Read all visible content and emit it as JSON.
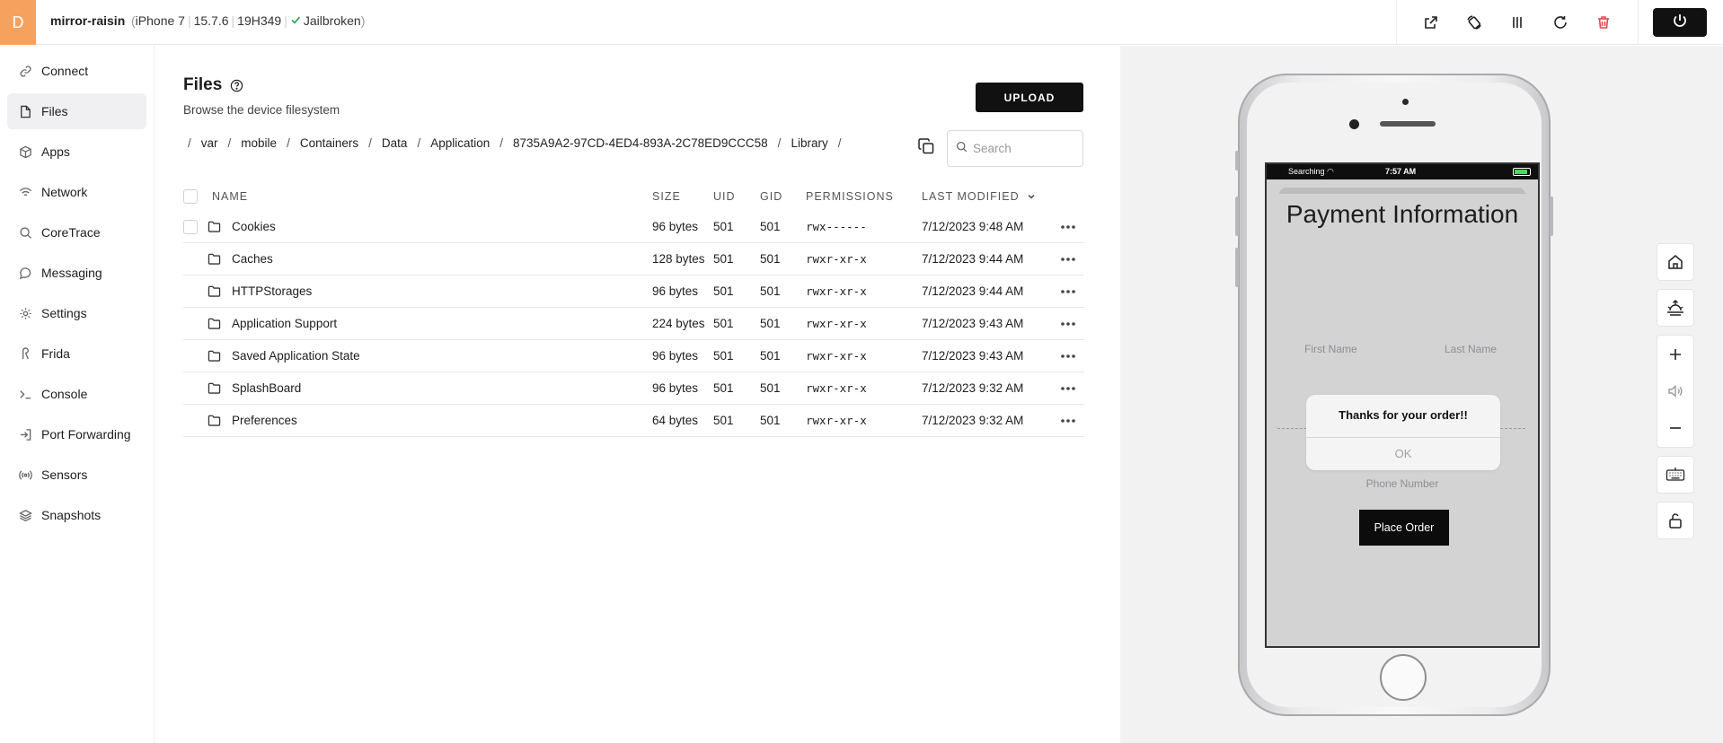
{
  "topbar": {
    "avatar_letter": "D",
    "device_name": "mirror-raisin",
    "device_model": "iPhone 7",
    "ios_version": "15.7.6",
    "build": "19H349",
    "jailbreak_status": "Jailbroken",
    "tools": [
      "external-link-icon",
      "rotate-device-icon",
      "pause-icon",
      "refresh-icon",
      "trash-icon"
    ],
    "power_icon": "power-icon"
  },
  "sidebar": {
    "items": [
      {
        "label": "Connect",
        "icon": "link-icon"
      },
      {
        "label": "Files",
        "icon": "file-icon",
        "active": true
      },
      {
        "label": "Apps",
        "icon": "cube-icon"
      },
      {
        "label": "Network",
        "icon": "wifi-icon"
      },
      {
        "label": "CoreTrace",
        "icon": "search-icon"
      },
      {
        "label": "Messaging",
        "icon": "chat-icon"
      },
      {
        "label": "Settings",
        "icon": "gear-icon"
      },
      {
        "label": "Frida",
        "icon": "frida-icon"
      },
      {
        "label": "Console",
        "icon": "terminal-icon"
      },
      {
        "label": "Port Forwarding",
        "icon": "login-icon"
      },
      {
        "label": "Sensors",
        "icon": "broadcast-icon"
      },
      {
        "label": "Snapshots",
        "icon": "layers-icon"
      }
    ]
  },
  "files": {
    "title": "Files",
    "subtitle": "Browse the device filesystem",
    "upload_label": "UPLOAD",
    "breadcrumb": [
      "var",
      "mobile",
      "Containers",
      "Data",
      "Application",
      "8735A9A2-97CD-4ED4-893A-2C78ED9CCC58",
      "Library"
    ],
    "search_placeholder": "Search",
    "columns": {
      "name": "NAME",
      "size": "SIZE",
      "uid": "UID",
      "gid": "GID",
      "permissions": "PERMISSIONS",
      "modified": "LAST MODIFIED"
    },
    "rows": [
      {
        "name": "Cookies",
        "size": "96 bytes",
        "uid": "501",
        "gid": "501",
        "perm": "rwx------",
        "modified": "7/12/2023 9:48 AM"
      },
      {
        "name": "Caches",
        "size": "128 bytes",
        "uid": "501",
        "gid": "501",
        "perm": "rwxr-xr-x",
        "modified": "7/12/2023 9:44 AM"
      },
      {
        "name": "HTTPStorages",
        "size": "96 bytes",
        "uid": "501",
        "gid": "501",
        "perm": "rwxr-xr-x",
        "modified": "7/12/2023 9:44 AM"
      },
      {
        "name": "Application Support",
        "size": "224 bytes",
        "uid": "501",
        "gid": "501",
        "perm": "rwxr-xr-x",
        "modified": "7/12/2023 9:43 AM"
      },
      {
        "name": "Saved Application State",
        "size": "96 bytes",
        "uid": "501",
        "gid": "501",
        "perm": "rwxr-xr-x",
        "modified": "7/12/2023 9:43 AM"
      },
      {
        "name": "SplashBoard",
        "size": "96 bytes",
        "uid": "501",
        "gid": "501",
        "perm": "rwxr-xr-x",
        "modified": "7/12/2023 9:32 AM"
      },
      {
        "name": "Preferences",
        "size": "64 bytes",
        "uid": "501",
        "gid": "501",
        "perm": "rwxr-xr-x",
        "modified": "7/12/2023 9:32 AM"
      }
    ]
  },
  "phone": {
    "status_left": "Searching",
    "status_time": "7:57 AM",
    "screen_title": "Payment Information",
    "first_name_placeholder": "First Name",
    "last_name_placeholder": "Last Name",
    "phone_placeholder": "Phone Number",
    "place_order_label": "Place Order",
    "alert_title": "Thanks for your order!!",
    "alert_ok": "OK"
  },
  "controls": [
    "home-icon",
    "sunrise-icon",
    "plus-icon",
    "volume-icon",
    "minus-icon",
    "keyboard-icon",
    "unlock-icon"
  ],
  "colors": {
    "avatar": "#f6a25e",
    "primary_button": "#111111",
    "device_panel_bg": "#f2f2f3",
    "jailbroken_check": "#2ea043"
  }
}
